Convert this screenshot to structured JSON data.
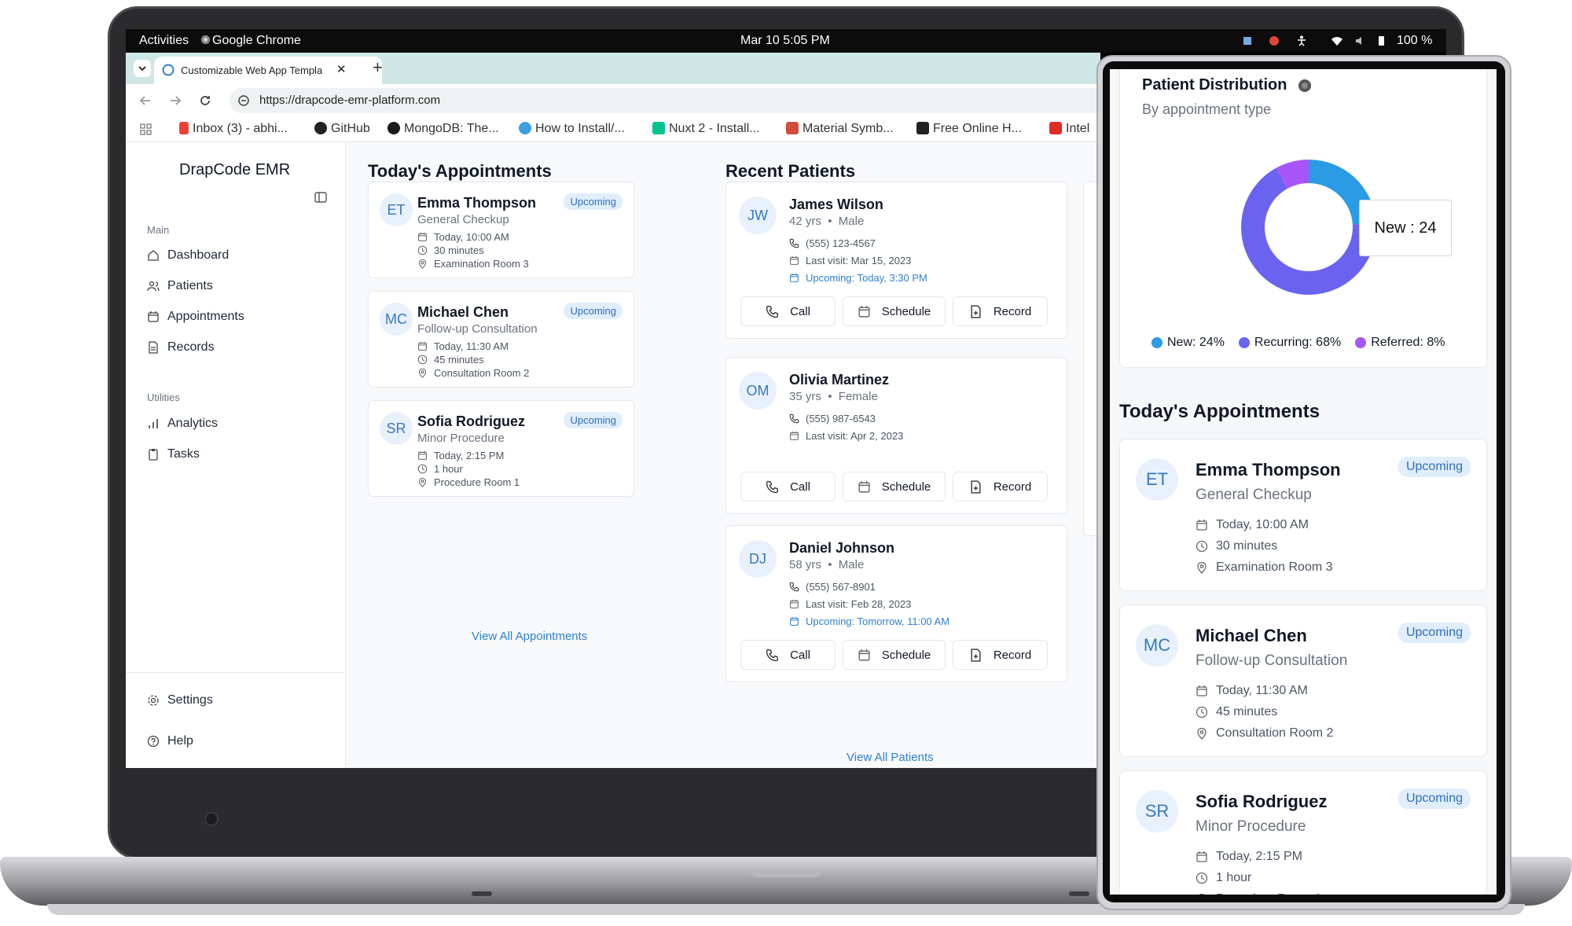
{
  "os_bar": {
    "activities": "Activities",
    "app": "Google Chrome",
    "datetime": "Mar 10  5:05 PM",
    "battery": "100 %"
  },
  "browser": {
    "tab_title": "Customizable Web App Templa",
    "new_tab": "+",
    "close": "✕",
    "url": "https://drapcode-emr-platform.com",
    "bookmarks": [
      "Inbox (3) - abhi...",
      "GitHub",
      "MongoDB: The...",
      "How to Install/...",
      "Nuxt 2 - Install...",
      "Material Symb...",
      "Free Online H...",
      "Intel"
    ]
  },
  "sidebar": {
    "brand": "DrapCode EMR",
    "main_label": "Main",
    "main_items": [
      "Dashboard",
      "Patients",
      "Appointments",
      "Records"
    ],
    "utilities_label": "Utilities",
    "utility_items": [
      "Analytics",
      "Tasks"
    ],
    "footer_items": [
      "Settings",
      "Help"
    ]
  },
  "appointments": {
    "title": "Today's Appointments",
    "items": [
      {
        "initials": "ET",
        "name": "Emma Thompson",
        "type": "General Checkup",
        "status": "Upcoming",
        "time": "Today, 10:00 AM",
        "duration": "30 minutes",
        "room": "Examination Room 3"
      },
      {
        "initials": "MC",
        "name": "Michael Chen",
        "type": "Follow-up Consultation",
        "status": "Upcoming",
        "time": "Today, 11:30 AM",
        "duration": "45 minutes",
        "room": "Consultation Room 2"
      },
      {
        "initials": "SR",
        "name": "Sofia Rodriguez",
        "type": "Minor Procedure",
        "status": "Upcoming",
        "time": "Today, 2:15 PM",
        "duration": "1 hour",
        "room": "Procedure Room 1"
      }
    ],
    "view_all": "View All Appointments"
  },
  "patients": {
    "title": "Recent Patients",
    "items": [
      {
        "initials": "JW",
        "name": "James Wilson",
        "age": "42 yrs",
        "gender": "Male",
        "phone": "(555) 123-4567",
        "last_visit": "Last visit: Mar 15, 2023",
        "upcoming": "Upcoming: Today, 3:30 PM"
      },
      {
        "initials": "OM",
        "name": "Olivia Martinez",
        "age": "35 yrs",
        "gender": "Female",
        "phone": "(555) 987-6543",
        "last_visit": "Last visit: Apr 2, 2023",
        "upcoming": ""
      },
      {
        "initials": "DJ",
        "name": "Daniel Johnson",
        "age": "58 yrs",
        "gender": "Male",
        "phone": "(555) 567-8901",
        "last_visit": "Last visit: Feb 28, 2023",
        "upcoming": "Upcoming: Tomorrow, 11:00 AM"
      }
    ],
    "actions": [
      "Call",
      "Schedule",
      "Record"
    ],
    "view_all": "View All Patients"
  },
  "mobile": {
    "chart_title": "Patient Distribution",
    "chart_subtitle": "By appointment type",
    "tooltip": "New : 24",
    "appointments_title": "Today's Appointments"
  },
  "chart_data": {
    "type": "pie",
    "title": "Patient Distribution",
    "subtitle": "By appointment type",
    "categories": [
      "New",
      "Recurring",
      "Referred"
    ],
    "values": [
      24,
      68,
      8
    ],
    "legend_labels": [
      "New: 24%",
      "Recurring: 68%",
      "Referred: 8%"
    ],
    "colors": [
      "#2b9be6",
      "#6a63ef",
      "#a855f7"
    ],
    "legend": "bottom"
  },
  "colors": {
    "accent": "#2f80d1",
    "badge_bg": "#e0edfb",
    "tab_strip": "#cfe6e6"
  }
}
